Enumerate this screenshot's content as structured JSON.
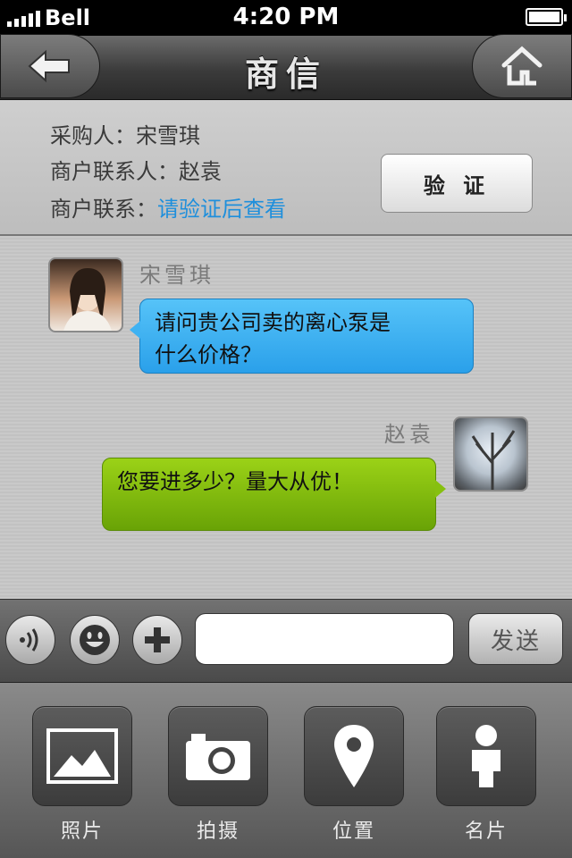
{
  "status_bar": {
    "carrier": "Bell",
    "time": "4:20 PM"
  },
  "nav": {
    "title": "商信",
    "back_icon": "back-arrow-icon",
    "home_icon": "home-icon"
  },
  "info": {
    "buyer_label": "采购人：",
    "buyer_name": "宋雪琪",
    "contact_person_label": "商户联系人：",
    "contact_person_name": "赵袁",
    "contact_label": "商户联系：",
    "contact_link": "请验证后查看",
    "verify_button": "验 证"
  },
  "messages": [
    {
      "sender": "宋雪琪",
      "line1": "请问贵公司卖的离心泵是",
      "line2": "什么价格？",
      "side": "left",
      "color": "#3fb2f2"
    },
    {
      "sender": "赵袁",
      "line1": "您要进多少？量大从优！",
      "side": "right",
      "color": "#86c00f"
    }
  ],
  "input_bar": {
    "voice_icon": "voice-icon",
    "emoji_icon": "emoji-icon",
    "plus_icon": "plus-icon",
    "message_value": "",
    "send_label": "发送"
  },
  "tools": [
    {
      "label": "照片",
      "icon": "photo-icon"
    },
    {
      "label": "拍摄",
      "icon": "camera-icon"
    },
    {
      "label": "位置",
      "icon": "location-pin-icon"
    },
    {
      "label": "名片",
      "icon": "person-card-icon"
    }
  ]
}
